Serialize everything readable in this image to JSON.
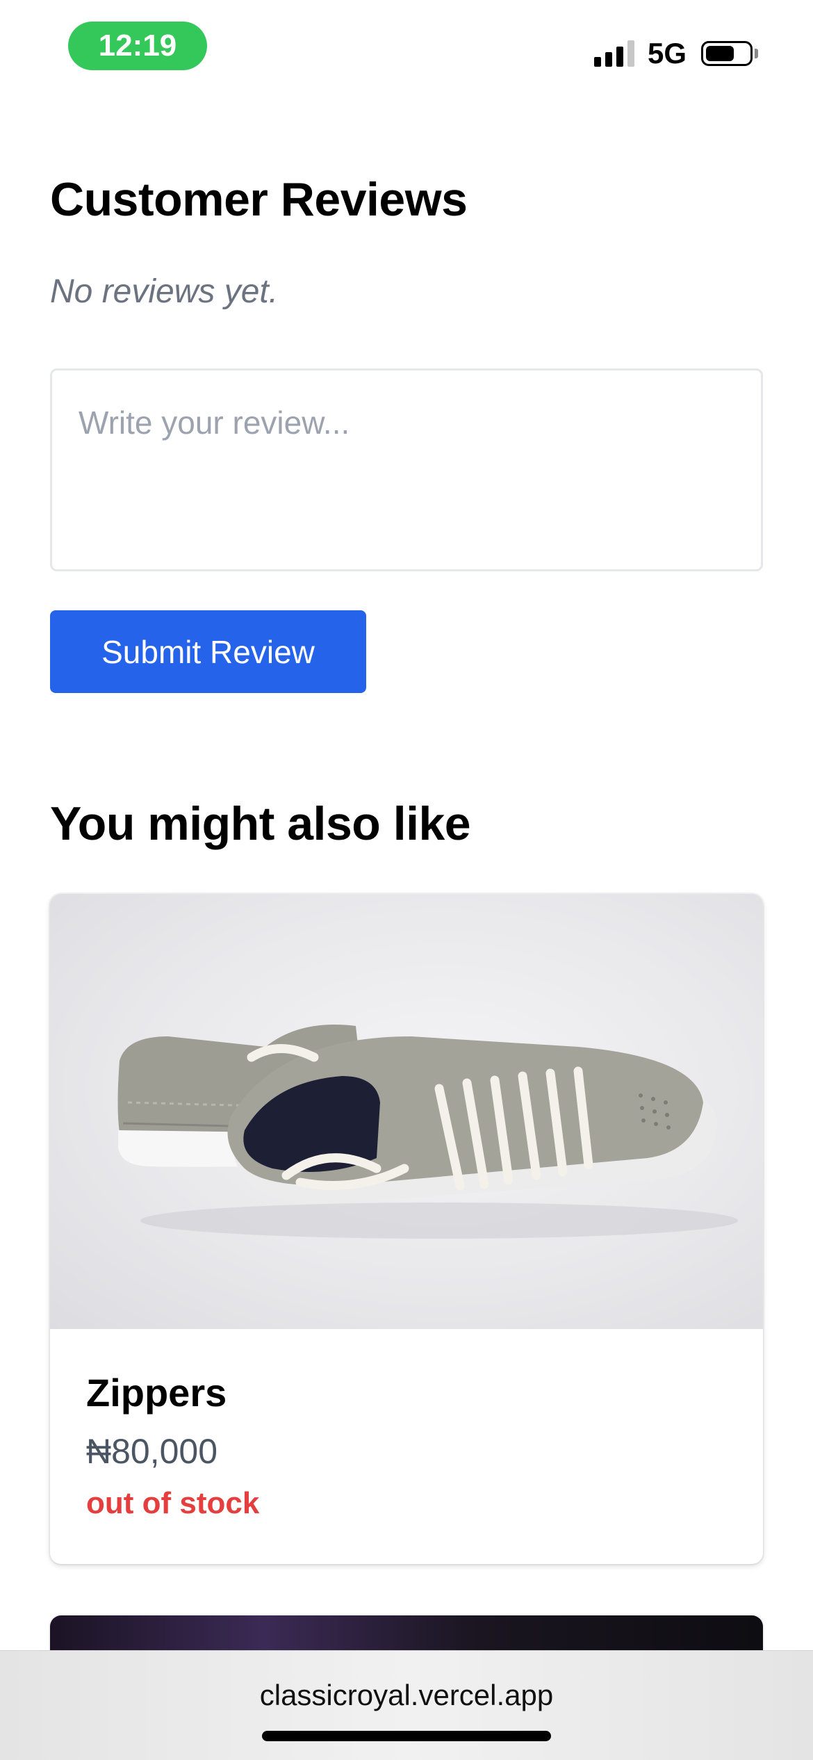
{
  "status_bar": {
    "time": "12:19",
    "network": "5G",
    "signal_bars_active": 3,
    "signal_bars_total": 4,
    "battery_level": 0.65,
    "time_pill_color": "#34c759"
  },
  "reviews": {
    "title": "Customer Reviews",
    "empty_message": "No reviews yet.",
    "input_placeholder": "Write your review...",
    "input_value": "",
    "submit_label": "Submit Review",
    "submit_color": "#2563eb"
  },
  "recommendations": {
    "title": "You might also like",
    "products": [
      {
        "name": "Zippers",
        "price": "₦80,000",
        "stock_status": "out of stock",
        "stock_color": "#e53e3e",
        "image_icon": "sneaker-image"
      }
    ]
  },
  "browser": {
    "url": "classicroyal.vercel.app"
  }
}
